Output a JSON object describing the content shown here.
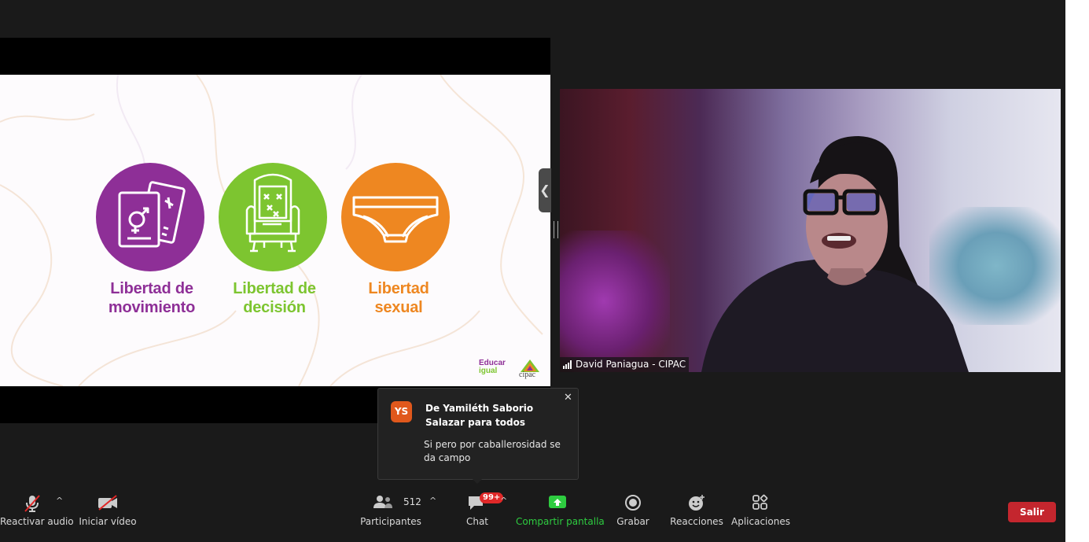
{
  "slide": {
    "items": [
      {
        "label_line1": "Libertad de",
        "label_line2": "movimiento",
        "icon": "passport-icon",
        "color": "#8e2f97"
      },
      {
        "label_line1": "Libertad de",
        "label_line2": "decisión",
        "icon": "throne-icon",
        "color": "#7dc530"
      },
      {
        "label_line1": "Libertad",
        "label_line2": "sexual",
        "icon": "underwear-icon",
        "color": "#ee8721"
      }
    ],
    "logo_educar_line1": "Educar",
    "logo_educar_line2": "igual",
    "logo_cipac": "cipac"
  },
  "video": {
    "participant_name": "David Paniagua - CIPAC"
  },
  "chat_notification": {
    "avatar_initials": "YS",
    "title": "De Yamiléth Saborio Salazar para todos",
    "message": "Si pero por caballerosidad se da campo"
  },
  "toolbar": {
    "audio_label": "Reactivar audio",
    "video_label": "Iniciar vídeo",
    "participants_label": "Participantes",
    "participants_count": "512",
    "chat_label": "Chat",
    "chat_badge": "99+",
    "share_label": "Compartir pantalla",
    "record_label": "Grabar",
    "reactions_label": "Reacciones",
    "apps_label": "Aplicaciones",
    "leave_label": "Salir"
  },
  "colors": {
    "background": "#1a1a1a",
    "leave_button": "#c4262e",
    "share_accent": "#2ecc40",
    "badge": "#e02828"
  }
}
